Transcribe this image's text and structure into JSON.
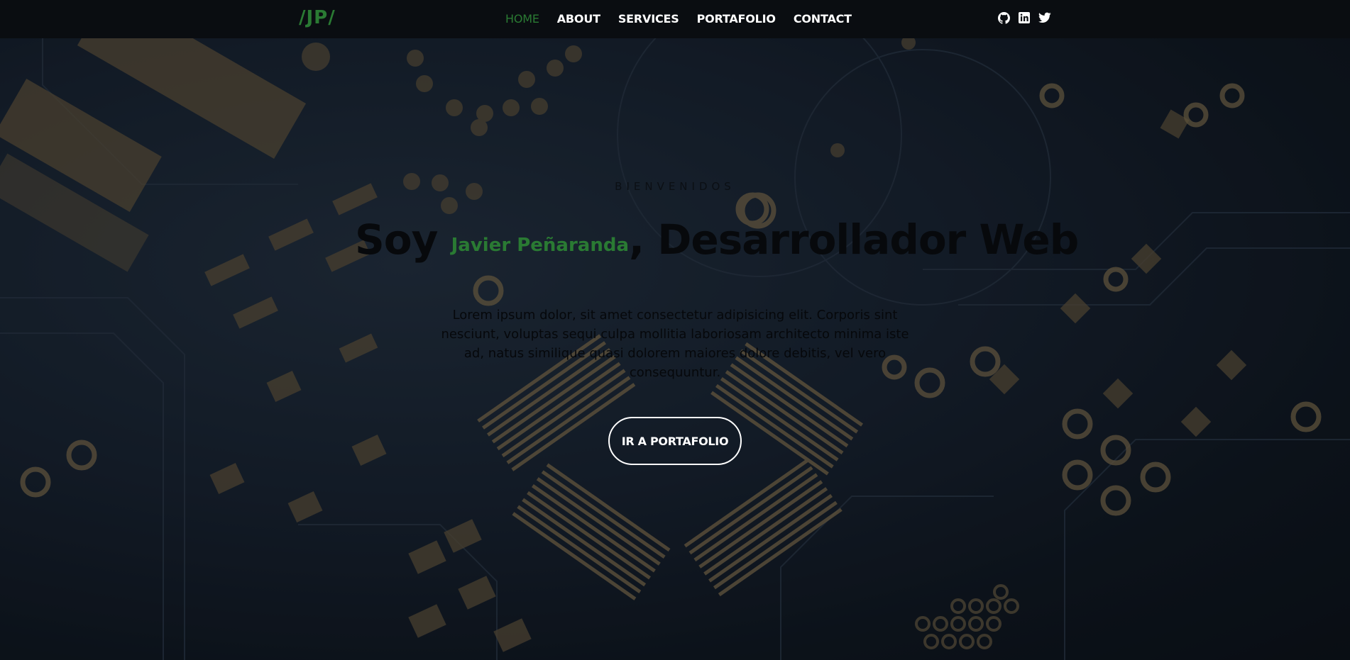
{
  "brand": {
    "logo_text": "/JP/",
    "accent_color": "#2a7a33"
  },
  "nav": {
    "items": [
      {
        "label": "HOME",
        "active": true
      },
      {
        "label": "ABOUT",
        "active": false
      },
      {
        "label": "SERVICES",
        "active": false
      },
      {
        "label": "PORTAFOLIO",
        "active": false
      },
      {
        "label": "CONTACT",
        "active": false
      }
    ]
  },
  "social": {
    "icons": [
      "github-icon",
      "linkedin-icon",
      "twitter-icon"
    ]
  },
  "hero": {
    "kicker": "BIENVENIDOS",
    "headline_prefix": "Soy ",
    "headline_name": "Javier Peñaranda",
    "headline_suffix": ", Desarrollador Web",
    "intro": "Lorem ipsum dolor, sit amet consectetur adipisicing elit. Corporis sint nesciunt, voluptas sequi culpa mollitia laboriosam architecto minima iste ad, natus similique quasi dolorem maiores dolore debitis, vel vero consequuntur.",
    "cta_label": "IR A PORTAFOLIO",
    "background": "circuit-board-image"
  }
}
